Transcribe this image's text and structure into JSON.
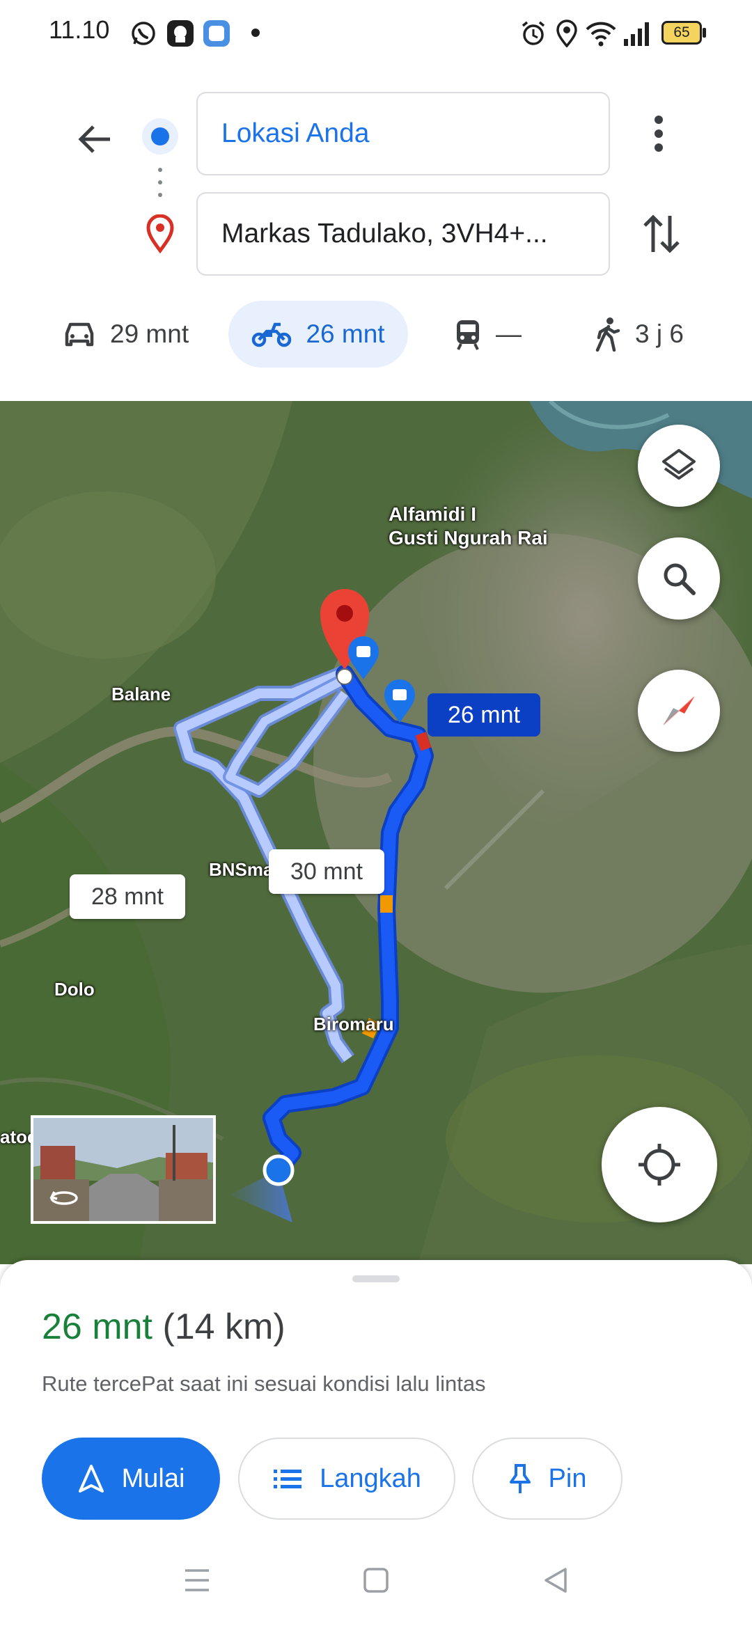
{
  "status_bar": {
    "time": "11.10",
    "battery": "65"
  },
  "search": {
    "origin_value": "Lokasi Anda",
    "destination_value": "Markas Tadulako, 3VH4+..."
  },
  "modes": [
    {
      "name": "car",
      "label": "29 mnt"
    },
    {
      "name": "motorcycle",
      "label": "26 mnt",
      "selected": true
    },
    {
      "name": "transit",
      "label": "—"
    },
    {
      "name": "walk",
      "label": "3 j 6"
    }
  ],
  "map": {
    "places": {
      "poi": "Alfamidi I\nGusti Ngurah Rai",
      "balane": "Balane",
      "bns": "BNSma",
      "dolo": "Dolo",
      "biromaru": "Biromaru",
      "atoenondje": "atoenondje"
    },
    "route_labels": {
      "primary": "26 mnt",
      "alt1": "28 mnt",
      "alt2": "30 mnt"
    },
    "colors": {
      "route_primary": "#1a5af5",
      "route_alt": "#a8c0ff",
      "traffic_slow": "#f29900",
      "traffic_heavy": "#d93025"
    }
  },
  "sheet": {
    "duration": "26 mnt",
    "distance": "(14 km)",
    "description": "Rute tercePat saat ini sesuai kondisi lalu lintas",
    "buttons": {
      "start": "Mulai",
      "steps": "Langkah",
      "pin": "Pin"
    }
  }
}
